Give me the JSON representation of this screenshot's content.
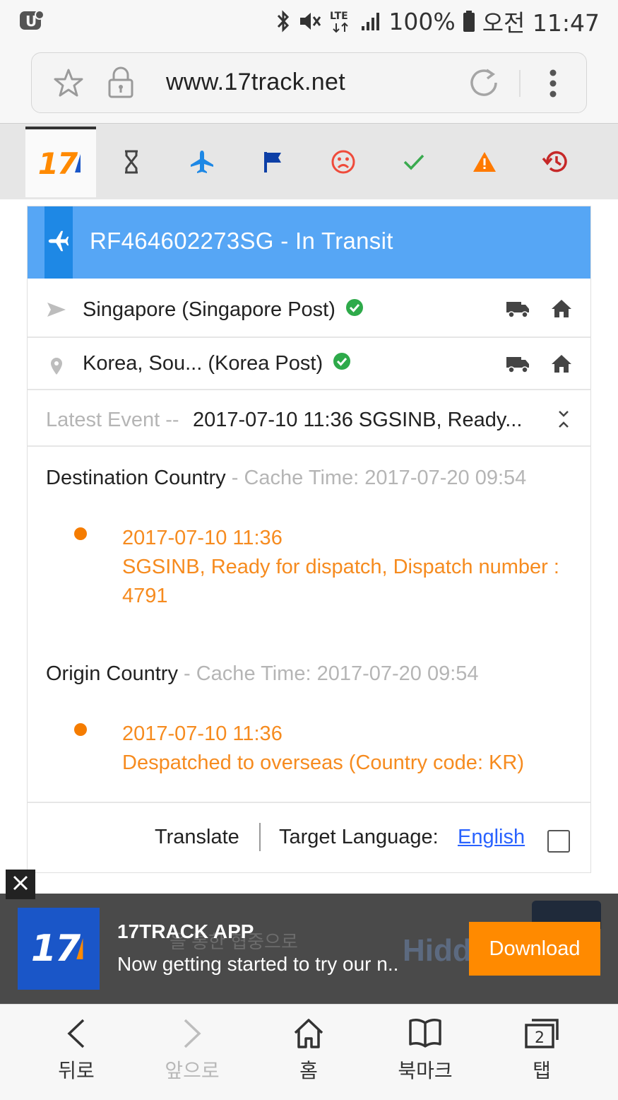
{
  "status_bar": {
    "battery": "100%",
    "time": "오전 11:47",
    "network": "LTE"
  },
  "browser": {
    "url": "www.17track.net"
  },
  "tabs": [
    {
      "name": "all",
      "icon": "17track-logo"
    },
    {
      "name": "pending",
      "icon": "hourglass-icon"
    },
    {
      "name": "in-transit",
      "icon": "airplane-icon"
    },
    {
      "name": "pickup",
      "icon": "flag-icon"
    },
    {
      "name": "undelivered",
      "icon": "sad-face-icon"
    },
    {
      "name": "delivered",
      "icon": "check-icon"
    },
    {
      "name": "alert",
      "icon": "warning-icon"
    },
    {
      "name": "expired",
      "icon": "history-icon"
    }
  ],
  "logo": {
    "text": "17"
  },
  "tracking": {
    "title": "RF464602273SG - In Transit",
    "origin": "Singapore (Singapore Post)",
    "destination": "Korea, Sou... (Korea Post)",
    "latest_label": "Latest Event --",
    "latest_value": "2017-07-10 11:36 SGSINB, Ready..."
  },
  "sections": {
    "destination": {
      "title": "Destination Country",
      "cache": " - Cache Time: 2017-07-20 09:54",
      "events": [
        {
          "time": "2017-07-10 11:36",
          "desc_line1": "SGSINB, Ready for dispatch, Dispatch number :",
          "desc_line2": "4791"
        }
      ]
    },
    "origin": {
      "title": "Origin Country",
      "cache": " - Cache Time: 2017-07-20 09:54",
      "events": [
        {
          "time": "2017-07-10 11:36",
          "desc_line1": "Despatched to overseas (Country code: KR)"
        }
      ]
    }
  },
  "translate": {
    "label": "Translate",
    "target_label": "Target Language:",
    "language": "English"
  },
  "ad": {
    "app_title": "17TRACK APP",
    "app_sub": "Now getting started to try our n..",
    "download": "Download",
    "bg_text": "을 통한 협중으로",
    "bg_brand": "Hidd"
  },
  "bottom_nav": {
    "back": "뒤로",
    "forward": "앞으로",
    "home": "홈",
    "bookmarks": "북마크",
    "tabs": "탭",
    "tab_count": "2"
  },
  "colors": {
    "header_blue": "#56a6f5",
    "event_orange": "#f68b1f",
    "download_orange": "#ff8a00",
    "check_green": "#2eaa4a"
  }
}
